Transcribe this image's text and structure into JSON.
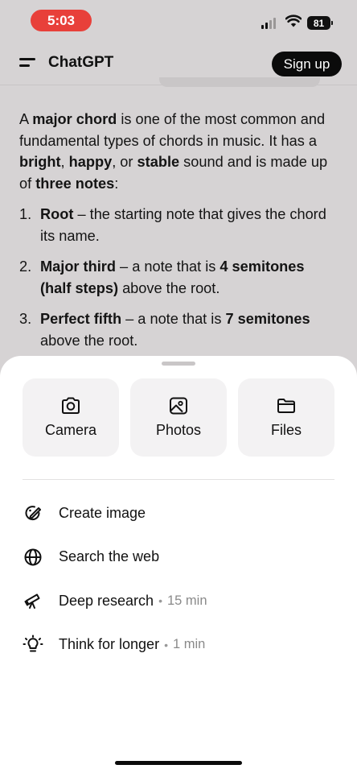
{
  "status": {
    "time": "5:03",
    "battery": "81"
  },
  "header": {
    "title": "ChatGPT",
    "signup_label": "Sign up"
  },
  "message": {
    "intro": [
      {
        "t": "A ",
        "b": false
      },
      {
        "t": "major chord",
        "b": true
      },
      {
        "t": " is one of the most common and fundamental types of chords in music. It has a ",
        "b": false
      },
      {
        "t": "bright",
        "b": true
      },
      {
        "t": ", ",
        "b": false
      },
      {
        "t": "happy",
        "b": true
      },
      {
        "t": ", or ",
        "b": false
      },
      {
        "t": "stable",
        "b": true
      },
      {
        "t": " sound and is made up of ",
        "b": false
      },
      {
        "t": "three notes",
        "b": true
      },
      {
        "t": ":",
        "b": false
      }
    ],
    "items": [
      {
        "num": "1.",
        "parts": [
          {
            "t": "Root",
            "b": true
          },
          {
            "t": " – the starting note that gives the chord its name.",
            "b": false
          }
        ]
      },
      {
        "num": "2.",
        "parts": [
          {
            "t": "Major third",
            "b": true
          },
          {
            "t": " – a note that is ",
            "b": false
          },
          {
            "t": "4 semitones (half steps)",
            "b": true
          },
          {
            "t": " above the root.",
            "b": false
          }
        ]
      },
      {
        "num": "3.",
        "parts": [
          {
            "t": "Perfect fifth",
            "b": true
          },
          {
            "t": " – a note that is ",
            "b": false
          },
          {
            "t": "7 semitones",
            "b": true
          },
          {
            "t": " above the root.",
            "b": false
          }
        ]
      }
    ]
  },
  "sheet": {
    "tiles": [
      {
        "label": "Camera",
        "icon": "camera-icon"
      },
      {
        "label": "Photos",
        "icon": "photos-icon"
      },
      {
        "label": "Files",
        "icon": "folder-icon"
      }
    ],
    "menu": [
      {
        "label": "Create image",
        "meta": "",
        "icon": "create-image-icon"
      },
      {
        "label": "Search the web",
        "meta": "",
        "icon": "globe-icon"
      },
      {
        "label": "Deep research",
        "meta": "15 min",
        "icon": "telescope-icon"
      },
      {
        "label": "Think for longer",
        "meta": "1 min",
        "icon": "lightbulb-icon"
      }
    ]
  },
  "colors": {
    "accent_status": "#e8403a",
    "sheet_bg": "#ffffff",
    "page_bg": "#d6d3d4"
  }
}
